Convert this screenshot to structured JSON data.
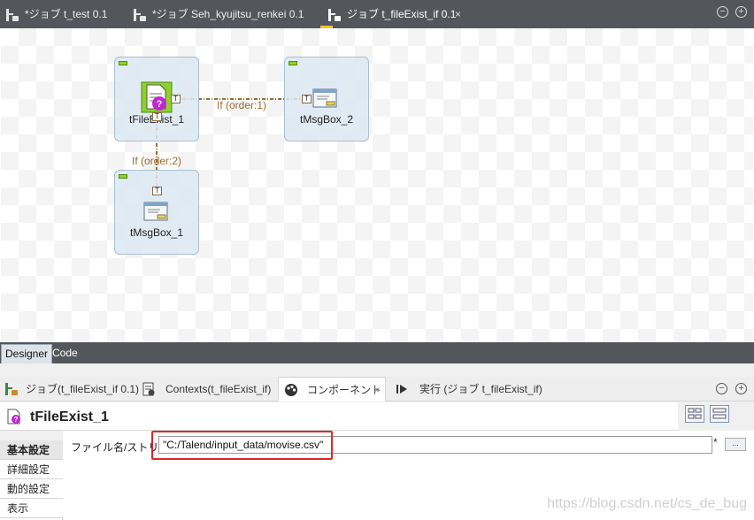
{
  "editor_tabs": [
    {
      "label": "*ジョブ t_test 0.1",
      "active": false
    },
    {
      "label": "*ジョブ Seh_kyujitsu_renkei 0.1",
      "active": false
    },
    {
      "label": "ジョブ t_fileExist_if 0.1",
      "active": true
    }
  ],
  "editor_tab_close": "×",
  "window_controls": {
    "minimize": "−",
    "maximize": "+"
  },
  "canvas": {
    "nodes": [
      {
        "label": "tFileExist_1",
        "icon": "file-exist-question-icon"
      },
      {
        "label": "tMsgBox_2",
        "icon": "message-box-icon"
      },
      {
        "label": "tMsgBox_1",
        "icon": "message-box-icon"
      }
    ],
    "connections": [
      {
        "label": "If (order:1)",
        "from": "tFileExist_1",
        "to": "tMsgBox_2"
      },
      {
        "label": "If (order:2)",
        "from": "tFileExist_1",
        "to": "tMsgBox_1"
      }
    ],
    "connector_glyph": "T",
    "connection_color": "#a06a2c"
  },
  "view_switch": {
    "designer": "Designer",
    "code": "Code",
    "active": "Designer"
  },
  "bottom_tabs": [
    {
      "label": "ジョブ(t_fileExist_if 0.1)",
      "icon": "job-icon"
    },
    {
      "label": "Contexts(t_fileExist_if)",
      "icon": "contexts-icon"
    },
    {
      "label": "コンポーネント",
      "icon": "component-icon",
      "active": true,
      "close": "×"
    },
    {
      "label": "実行 (ジョブ t_fileExist_if)",
      "icon": "run-icon"
    }
  ],
  "component": {
    "title": "tFileExist_1"
  },
  "settings_nav": [
    {
      "label": "基本設定",
      "active": true
    },
    {
      "label": "詳細設定",
      "active": false
    },
    {
      "label": "動的設定",
      "active": false
    },
    {
      "label": "表示",
      "active": false
    }
  ],
  "field": {
    "label": "ファイル名/ストリーム",
    "value": "\"C:/Talend/input_data/movise.csv\"",
    "required_mark": "*",
    "browse_label": "..."
  },
  "highlight_color": "#d62a2a",
  "accent_color": "#f1c232",
  "watermark": "https://blog.csdn.net/cs_de_bug"
}
